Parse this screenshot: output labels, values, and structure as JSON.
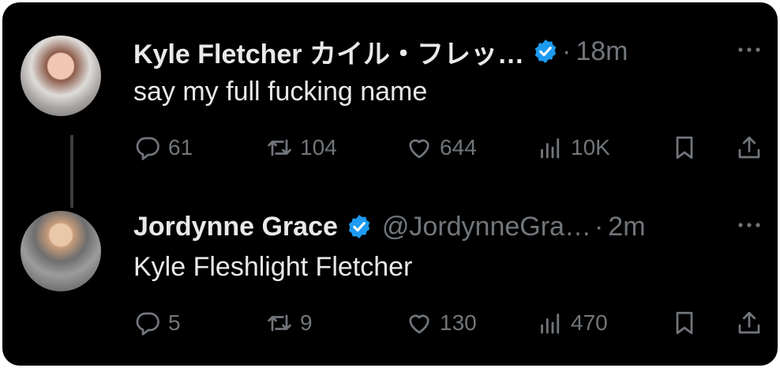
{
  "tweets": [
    {
      "display_name": "Kyle Fletcher カイル・フレッ…",
      "handle": "",
      "time": "18m",
      "text": "say my full fucking name",
      "replies": "61",
      "reposts": "104",
      "likes": "644",
      "views": "10K"
    },
    {
      "display_name": "Jordynne Grace",
      "handle": "@JordynneGra…",
      "time": "2m",
      "text": "Kyle Fleshlight Fletcher",
      "replies": "5",
      "reposts": "9",
      "likes": "130",
      "views": "470"
    }
  ],
  "separator": "·",
  "icons": {
    "verified": "verified-badge-icon",
    "more": "more-icon",
    "reply": "reply-icon",
    "repost": "repost-icon",
    "like": "like-icon",
    "views": "views-icon",
    "bookmark": "bookmark-icon",
    "share": "share-icon"
  },
  "colors": {
    "background": "#000000",
    "primary_text": "#e7e9ea",
    "secondary_text": "#71767b",
    "verified_blue": "#1d9bf0"
  }
}
